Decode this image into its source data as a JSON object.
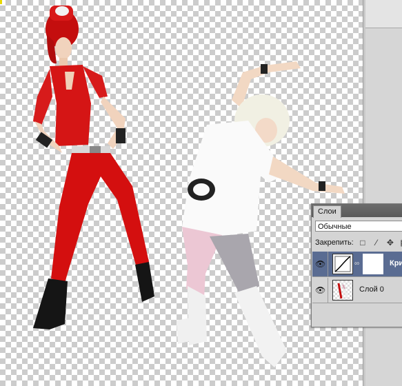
{
  "layers_panel": {
    "tab_label": "Слои",
    "blend_mode": "Обычные",
    "lock_label": "Закрепить:",
    "lock_icons": [
      "lock-transparent-icon",
      "lock-brush-icon",
      "lock-move-icon",
      "lock-all-icon"
    ],
    "layers": [
      {
        "name": "Кри",
        "type": "curves-adjustment",
        "selected": true,
        "visible": true
      },
      {
        "name": "Слой 0",
        "type": "pixel",
        "selected": false,
        "visible": true
      }
    ]
  },
  "colors": {
    "selection": "#5a6c92",
    "canvas_checker": "#cccccc",
    "workspace": "#c8c8c8"
  }
}
